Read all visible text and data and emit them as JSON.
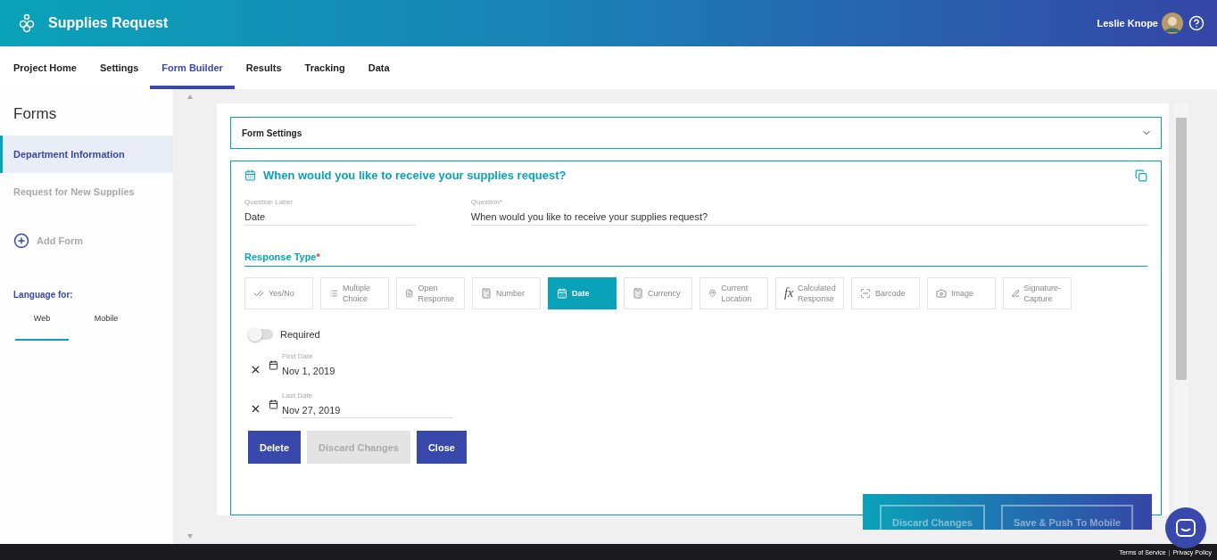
{
  "app": {
    "title": "Supplies Request",
    "user": "Leslie Knope"
  },
  "nav": [
    {
      "label": "Project Home",
      "selected": false
    },
    {
      "label": "Settings",
      "selected": false
    },
    {
      "label": "Form Builder",
      "selected": true
    },
    {
      "label": "Results",
      "selected": false
    },
    {
      "label": "Tracking",
      "selected": false
    },
    {
      "label": "Data",
      "selected": false
    }
  ],
  "sidebar": {
    "title": "Forms",
    "forms": [
      {
        "label": "Department Information",
        "selected": true
      },
      {
        "label": "Request for New Supplies",
        "selected": false
      }
    ],
    "add_form": "Add Form",
    "language_label": "Language for:",
    "language_tabs": [
      {
        "label": "Web",
        "selected": true
      },
      {
        "label": "Mobile",
        "selected": false
      }
    ]
  },
  "form_settings": {
    "label": "Form Settings",
    "expanded": false
  },
  "question": {
    "title": "When would you like to receive your supplies request?",
    "label_field": {
      "label": "Question Label",
      "value": "Date"
    },
    "question_field": {
      "label": "Question*",
      "value": "When would you like to receive your supplies request?"
    },
    "response_type_label": "Response Type",
    "required_mark": "*",
    "response_types": [
      {
        "kind": "yesno",
        "label": "Yes/No",
        "selected": false
      },
      {
        "kind": "choice",
        "label": "Multiple Choice",
        "selected": false
      },
      {
        "kind": "open",
        "label": "Open Response",
        "selected": false
      },
      {
        "kind": "number",
        "label": "Number",
        "selected": false
      },
      {
        "kind": "date",
        "label": "Date",
        "selected": true
      },
      {
        "kind": "currency",
        "label": "Currency",
        "selected": false
      },
      {
        "kind": "location",
        "label": "Current Location",
        "selected": false
      },
      {
        "kind": "calc",
        "label": "Calculated Response",
        "selected": false
      },
      {
        "kind": "barcode",
        "label": "Barcode",
        "selected": false
      },
      {
        "kind": "image",
        "label": "Image",
        "selected": false
      },
      {
        "kind": "signature",
        "label": "Signature-Capture",
        "selected": false
      }
    ],
    "calc_symbol": "fx",
    "required": {
      "label": "Required",
      "on": false
    },
    "dates": [
      {
        "label": "First Date",
        "value": "Nov 1, 2019",
        "underlined": false
      },
      {
        "label": "Last Date",
        "value": "Nov 27, 2019",
        "underlined": true
      }
    ],
    "buttons": [
      {
        "kind": "primary",
        "label": "Delete",
        "disabled": false
      },
      {
        "kind": "secondary",
        "label": "Discard Changes",
        "disabled": true
      },
      {
        "kind": "primary",
        "label": "Close",
        "disabled": false
      }
    ]
  },
  "action_bar": {
    "buttons": [
      {
        "label": "Discard Changes",
        "disabled": true
      },
      {
        "label": "Save & Push To Mobile",
        "disabled": true
      }
    ]
  },
  "footer": {
    "links": [
      "Terms of Service",
      "Privacy Policy"
    ],
    "separator": "|"
  }
}
